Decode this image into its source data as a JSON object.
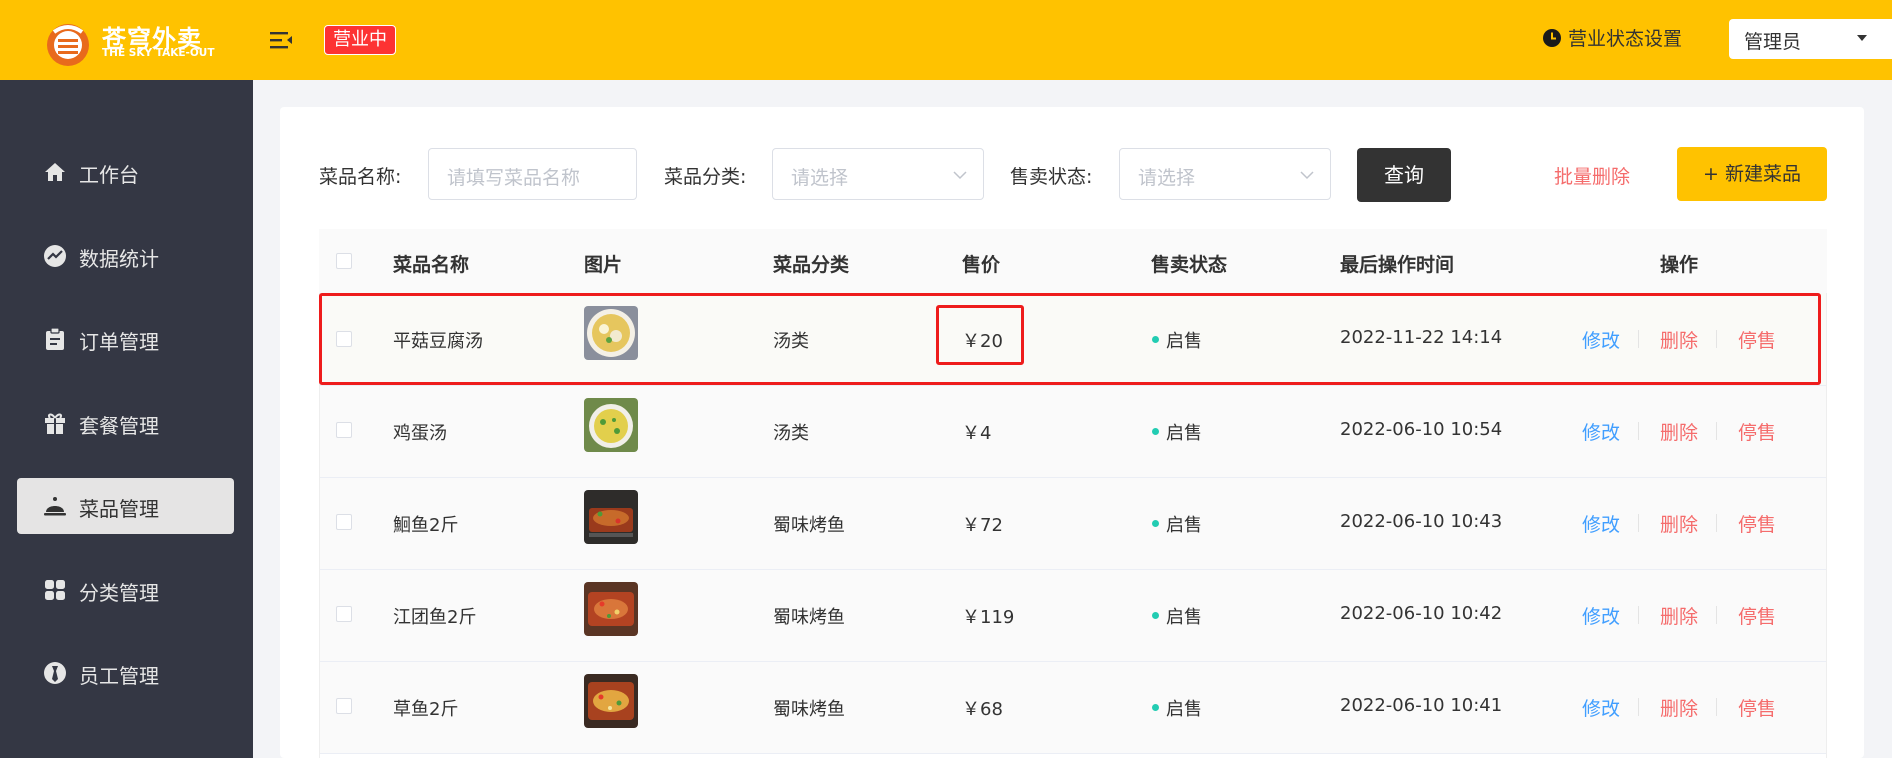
{
  "header": {
    "logo_cn": "苍穹外卖",
    "logo_en": "THE SKY TAKE-OUT",
    "status_badge": "营业中",
    "business_setting": "营业状态设置",
    "user": "管理员",
    "colors": {
      "header_bg": "#ffc200",
      "badge_bg": "#fd3333"
    }
  },
  "sidebar": {
    "items": [
      {
        "label": "工作台",
        "icon": "home-icon"
      },
      {
        "label": "数据统计",
        "icon": "chart-icon"
      },
      {
        "label": "订单管理",
        "icon": "clipboard-icon"
      },
      {
        "label": "套餐管理",
        "icon": "gift-icon"
      },
      {
        "label": "菜品管理",
        "icon": "cloche-icon",
        "active": true
      },
      {
        "label": "分类管理",
        "icon": "grid-icon"
      },
      {
        "label": "员工管理",
        "icon": "employee-icon"
      }
    ]
  },
  "filters": {
    "name_label": "菜品名称:",
    "name_placeholder": "请填写菜品名称",
    "category_label": "菜品分类:",
    "category_placeholder": "请选择",
    "status_label": "售卖状态:",
    "status_placeholder": "请选择",
    "query_button": "查询"
  },
  "actions": {
    "batch_delete": "批量删除",
    "new_dish": "+ 新建菜品"
  },
  "table": {
    "columns": [
      "菜品名称",
      "图片",
      "菜品分类",
      "售价",
      "售卖状态",
      "最后操作时间",
      "操作"
    ],
    "row_actions": {
      "edit": "修改",
      "delete": "删除",
      "stop": "停售"
    },
    "rows": [
      {
        "name": "平菇豆腐汤",
        "category": "汤类",
        "price": "￥20",
        "status": "启售",
        "time": "2022-11-22 14:14"
      },
      {
        "name": "鸡蛋汤",
        "category": "汤类",
        "price": "￥4",
        "status": "启售",
        "time": "2022-06-10 10:54"
      },
      {
        "name": "鮰鱼2斤",
        "category": "蜀味烤鱼",
        "price": "￥72",
        "status": "启售",
        "time": "2022-06-10 10:43"
      },
      {
        "name": "江团鱼2斤",
        "category": "蜀味烤鱼",
        "price": "￥119",
        "status": "启售",
        "time": "2022-06-10 10:42"
      },
      {
        "name": "草鱼2斤",
        "category": "蜀味烤鱼",
        "price": "￥68",
        "status": "启售",
        "time": "2022-06-10 10:41"
      }
    ]
  }
}
